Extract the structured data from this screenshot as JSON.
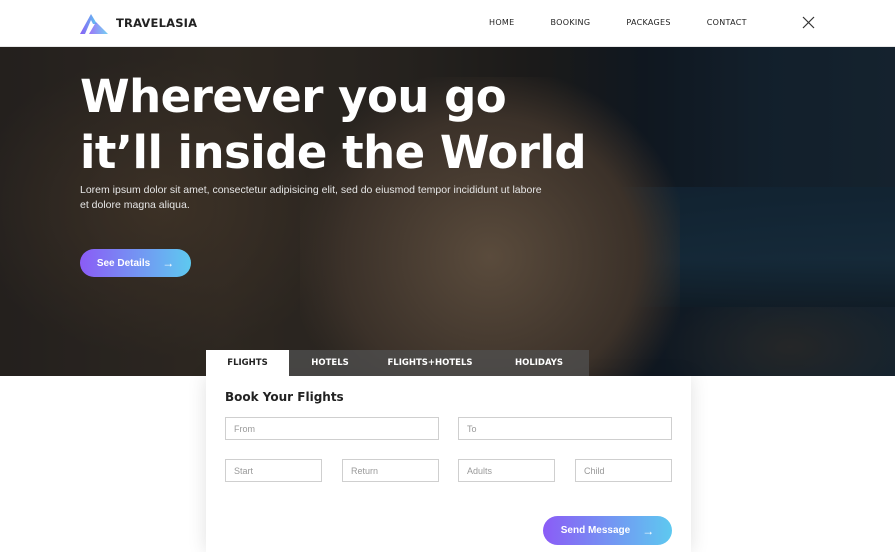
{
  "brand": {
    "name": "TRAVELASIA",
    "logo_icon": "mountain-logo-icon"
  },
  "nav": {
    "items": [
      {
        "label": "HOME"
      },
      {
        "label": "BOOKING"
      },
      {
        "label": "PACKAGES"
      },
      {
        "label": "CONTACT"
      }
    ],
    "close_icon": "close-icon"
  },
  "hero": {
    "title_line1": "Wherever you go",
    "title_line2": "it’ll inside the World",
    "description": "Lorem ipsum dolor sit amet, consectetur adipisicing elit, sed do eiusmod tempor incididunt ut labore et dolore magna aliqua.",
    "cta_label": "See Details",
    "cta_icon": "arrow-right-icon"
  },
  "tabs": [
    {
      "label": "FLIGHTS",
      "active": true
    },
    {
      "label": "HOTELS",
      "active": false
    },
    {
      "label": "FLIGHTS+HOTELS",
      "active": false
    },
    {
      "label": "HOLIDAYS",
      "active": false
    }
  ],
  "booking": {
    "title": "Book Your Flights",
    "fields": {
      "from": {
        "placeholder": "From",
        "value": ""
      },
      "to": {
        "placeholder": "To",
        "value": ""
      },
      "start": {
        "placeholder": "Start",
        "value": ""
      },
      "return": {
        "placeholder": "Return",
        "value": ""
      },
      "adults": {
        "placeholder": "Adults",
        "value": ""
      },
      "child": {
        "placeholder": "Child",
        "value": ""
      }
    },
    "submit_label": "Send Message",
    "submit_icon": "arrow-right-icon"
  },
  "colors": {
    "accent_start": "#8b5cf6",
    "accent_end": "#5ec9f0",
    "text_dark": "#222222"
  }
}
